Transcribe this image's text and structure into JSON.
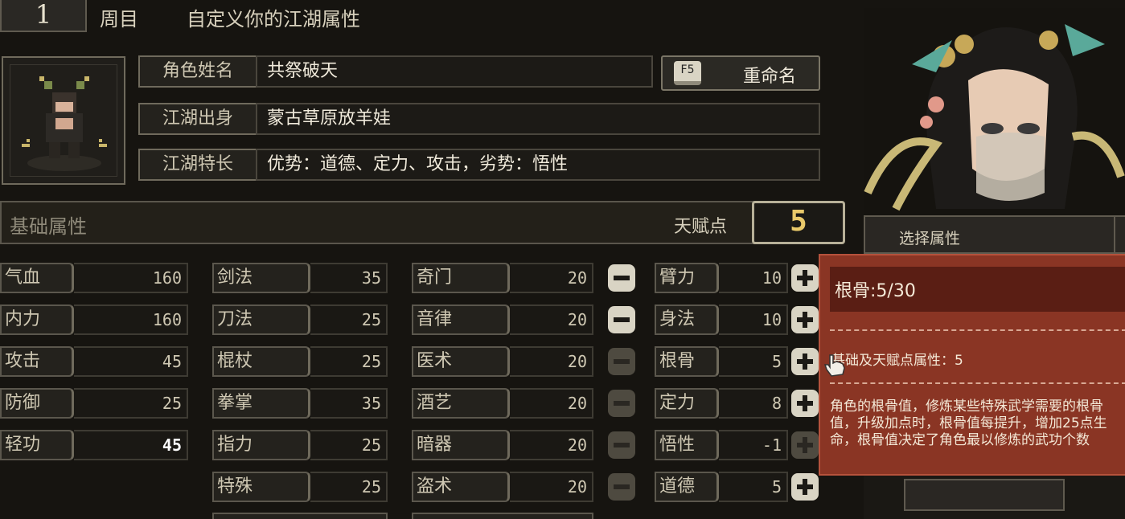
{
  "header": {
    "cycle_number": "1",
    "cycle_label": "周目",
    "title": "自定义你的江湖属性"
  },
  "character": {
    "name_label": "角色姓名",
    "name_value": "共祭破天",
    "origin_label": "江湖出身",
    "origin_value": "蒙古草原放羊娃",
    "trait_label": "江湖特长",
    "trait_value": "优势：道德、定力、攻击，劣势：悟性",
    "rename_key": "F5",
    "rename_label": "重命名"
  },
  "base_attributes": {
    "title": "基础属性",
    "talent_points_label": "天赋点",
    "talent_points": "5"
  },
  "stats_col1": [
    {
      "label": "气血",
      "value": "160"
    },
    {
      "label": "内力",
      "value": "160"
    },
    {
      "label": "攻击",
      "value": "45"
    },
    {
      "label": "防御",
      "value": "25"
    },
    {
      "label": "轻功",
      "value": "45"
    }
  ],
  "stats_col2": [
    {
      "label": "剑法",
      "value": "35"
    },
    {
      "label": "刀法",
      "value": "25"
    },
    {
      "label": "棍杖",
      "value": "25"
    },
    {
      "label": "拳掌",
      "value": "35"
    },
    {
      "label": "指力",
      "value": "25"
    },
    {
      "label": "特殊",
      "value": "25"
    }
  ],
  "stats_col3": [
    {
      "label": "奇门",
      "value": "20"
    },
    {
      "label": "音律",
      "value": "20"
    },
    {
      "label": "医术",
      "value": "20"
    },
    {
      "label": "酒艺",
      "value": "20"
    },
    {
      "label": "暗器",
      "value": "20"
    },
    {
      "label": "盗术",
      "value": "20"
    }
  ],
  "stats_col4": [
    {
      "label": "臂力",
      "value": "10",
      "minus_enabled": true,
      "plus_enabled": true
    },
    {
      "label": "身法",
      "value": "10",
      "minus_enabled": true,
      "plus_enabled": true
    },
    {
      "label": "根骨",
      "value": "5",
      "minus_enabled": false,
      "plus_enabled": true
    },
    {
      "label": "定力",
      "value": "8",
      "minus_enabled": false,
      "plus_enabled": true
    },
    {
      "label": "悟性",
      "value": "-1",
      "minus_enabled": false,
      "plus_enabled": false
    },
    {
      "label": "道德",
      "value": "5",
      "minus_enabled": false,
      "plus_enabled": true
    }
  ],
  "right_panel": {
    "select_label": "选择属性"
  },
  "tooltip": {
    "title": "根骨:5/30",
    "base_line": "基础及天赋点属性：5",
    "description": "角色的根骨值，修炼某些特殊武学需要的根骨值，升级加点时，根骨值每提升，增加25点生命，根骨值决定了角色最以修炼的武功个数"
  },
  "colors": {
    "tooltip_bg": "#8a3524",
    "talent_value": "#e9c96a",
    "background": "#161410"
  }
}
